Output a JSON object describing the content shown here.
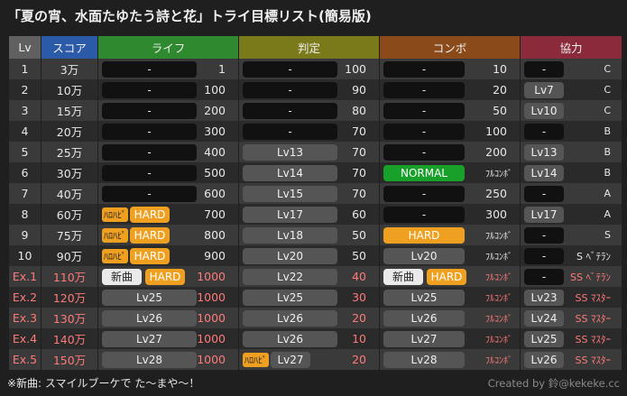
{
  "title": "「夏の宵、水面たゆたう詩と花」トライ目標リスト(簡易版)",
  "headers": {
    "lv": "Lv",
    "score": "スコア",
    "life": "ライフ",
    "judge": "判定",
    "combo": "コンボ",
    "coop": "協力"
  },
  "rows": [
    {
      "lv": "1",
      "score": "3万",
      "life_label": "-",
      "life_num": "1",
      "judge_label": "-",
      "judge_num": "100",
      "combo_label": "-",
      "combo_num": "10",
      "coop_label": "-",
      "coop_rank": "C"
    },
    {
      "lv": "2",
      "score": "10万",
      "life_label": "-",
      "life_num": "100",
      "judge_label": "-",
      "judge_num": "90",
      "combo_label": "-",
      "combo_num": "20",
      "coop_label": "Lv7",
      "coop_rank": "C"
    },
    {
      "lv": "3",
      "score": "15万",
      "life_label": "-",
      "life_num": "200",
      "judge_label": "-",
      "judge_num": "80",
      "combo_label": "-",
      "combo_num": "50",
      "coop_label": "Lv10",
      "coop_rank": "C"
    },
    {
      "lv": "4",
      "score": "20万",
      "life_label": "-",
      "life_num": "300",
      "judge_label": "-",
      "judge_num": "70",
      "combo_label": "-",
      "combo_num": "100",
      "coop_label": "-",
      "coop_rank": "B"
    },
    {
      "lv": "5",
      "score": "25万",
      "life_label": "-",
      "life_num": "400",
      "judge_label": "Lv13",
      "judge_num": "70",
      "combo_label": "-",
      "combo_num": "200",
      "coop_label": "Lv13",
      "coop_rank": "B"
    },
    {
      "lv": "6",
      "score": "30万",
      "life_label": "-",
      "life_num": "500",
      "judge_label": "Lv14",
      "judge_num": "70",
      "combo_label": "NORMAL",
      "combo_num": "ﾌﾙｺﾝﾎﾞ",
      "coop_label": "Lv14",
      "coop_rank": "B"
    },
    {
      "lv": "7",
      "score": "40万",
      "life_label": "-",
      "life_num": "600",
      "judge_label": "Lv15",
      "judge_num": "70",
      "combo_label": "-",
      "combo_num": "250",
      "coop_label": "-",
      "coop_rank": "A"
    },
    {
      "lv": "8",
      "score": "60万",
      "life_hh": "ﾊﾛﾊﾋﾟ",
      "life_label": "HARD",
      "life_num": "700",
      "judge_label": "Lv17",
      "judge_num": "60",
      "combo_label": "-",
      "combo_num": "300",
      "coop_label": "Lv17",
      "coop_rank": "A"
    },
    {
      "lv": "9",
      "score": "75万",
      "life_hh": "ﾊﾛﾊﾋﾟ",
      "life_label": "HARD",
      "life_num": "800",
      "judge_label": "Lv18",
      "judge_num": "50",
      "combo_label": "HARD",
      "combo_num": "ﾌﾙｺﾝﾎﾞ",
      "coop_label": "-",
      "coop_rank": "S"
    },
    {
      "lv": "10",
      "score": "90万",
      "life_hh": "ﾊﾛﾊﾋﾟ",
      "life_label": "HARD",
      "life_num": "900",
      "judge_label": "Lv20",
      "judge_num": "50",
      "combo_label": "Lv20",
      "combo_num": "ﾌﾙｺﾝﾎﾞ",
      "coop_label": "-",
      "coop_rank": "S ﾍﾞﾃﾗﾝ"
    },
    {
      "lv": "Ex.1",
      "score": "110万",
      "life_new": "新曲",
      "life_label": "HARD",
      "life_num": "1000",
      "judge_label": "Lv22",
      "judge_num": "40",
      "combo_new": "新曲",
      "combo_label": "HARD",
      "combo_num": "ﾌﾙｺﾝﾎﾞ",
      "coop_label": "-",
      "coop_rank": "SS ﾍﾞﾃﾗﾝ"
    },
    {
      "lv": "Ex.2",
      "score": "120万",
      "life_label": "Lv25",
      "life_num": "1000",
      "judge_label": "Lv25",
      "judge_num": "30",
      "combo_label": "Lv25",
      "combo_num": "ﾌﾙｺﾝﾎﾞ",
      "coop_label": "Lv23",
      "coop_rank": "SS ﾏｽﾀｰ"
    },
    {
      "lv": "Ex.3",
      "score": "130万",
      "life_label": "Lv26",
      "life_num": "1000",
      "judge_label": "Lv26",
      "judge_num": "20",
      "combo_label": "Lv26",
      "combo_num": "ﾌﾙｺﾝﾎﾞ",
      "coop_label": "Lv24",
      "coop_rank": "SS ﾏｽﾀｰ"
    },
    {
      "lv": "Ex.4",
      "score": "140万",
      "life_label": "Lv27",
      "life_num": "1000",
      "judge_label": "Lv26",
      "judge_num": "10",
      "combo_label": "Lv27",
      "combo_num": "ﾌﾙｺﾝﾎﾞ",
      "coop_label": "Lv25",
      "coop_rank": "SS ﾏｽﾀｰ"
    },
    {
      "lv": "Ex.5",
      "score": "150万",
      "life_label": "Lv28",
      "life_num": "1000",
      "judge_hh": "ﾊﾛﾊﾋﾟ",
      "judge_label": "Lv27",
      "judge_num": "20",
      "combo_label": "Lv28",
      "combo_num": "ﾌﾙｺﾝﾎﾞ",
      "coop_label": "Lv26",
      "coop_rank": "SS ﾏｽﾀｰ"
    }
  ],
  "footer_note": "※新曲: スマイルブーケで た～まや～！",
  "credit": "Created by 鈴@kekeke.cc"
}
